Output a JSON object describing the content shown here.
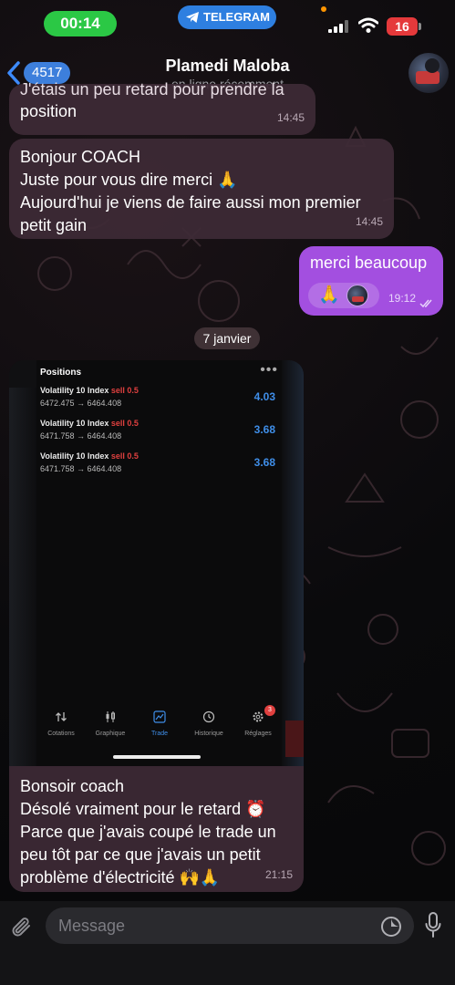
{
  "status_bar": {
    "time": "00:14",
    "app_pill": "TELEGRAM",
    "battery": "16"
  },
  "header": {
    "back_count": "4517",
    "title": "Plamedi Maloba",
    "status": "en ligne récemment"
  },
  "messages": [
    {
      "direction": "in",
      "lines": [
        "J'étais un peu retard pour prendre la",
        "position"
      ],
      "time": "14:45"
    },
    {
      "direction": "in",
      "lines": [
        "Bonjour COACH",
        "Juste pour vous dire merci 🙏",
        "Aujourd'hui je viens de faire aussi mon premier",
        "petit gain"
      ],
      "time": "14:45"
    },
    {
      "direction": "out",
      "lines": [
        "merci beaucoup"
      ],
      "reaction": "🙏",
      "time": "19:12"
    }
  ],
  "date_separator": "7 janvier",
  "screenshot": {
    "title": "Positions",
    "more": "•••",
    "positions": [
      {
        "name": "Volatility 10 Index",
        "side": "sell 0.5",
        "range": "6472.475 → 6464.408",
        "value": "4.03"
      },
      {
        "name": "Volatility 10 Index",
        "side": "sell 0.5",
        "range": "6471.758 → 6464.408",
        "value": "3.68"
      },
      {
        "name": "Volatility 10 Index",
        "side": "sell 0.5",
        "range": "6471.758 → 6464.408",
        "value": "3.68"
      }
    ],
    "nav": [
      {
        "label": "Cotations",
        "icon": "quotes-icon"
      },
      {
        "label": "Graphique",
        "icon": "candles-icon"
      },
      {
        "label": "Trade",
        "icon": "trade-chart-icon",
        "active": true
      },
      {
        "label": "Historique",
        "icon": "history-icon"
      },
      {
        "label": "Réglages",
        "icon": "gear-icon",
        "badge": "3"
      }
    ]
  },
  "caption": {
    "lines": [
      "Bonsoir coach",
      "Désolé vraiment pour le retard ⏰",
      "Parce que j'avais coupé le trade un",
      "peu tôt par ce que j'avais un petit",
      "problème d'électricité 🙌🙏"
    ],
    "time": "21:15"
  },
  "composer": {
    "placeholder": "Message"
  },
  "colors": {
    "outgoing_bubble": "#a34fe0",
    "incoming_bubble": "#3e2a36",
    "accent": "#3d7fdc",
    "time_pill": "#2bc845",
    "sell": "#e0403f",
    "profit": "#3f8ee8"
  }
}
